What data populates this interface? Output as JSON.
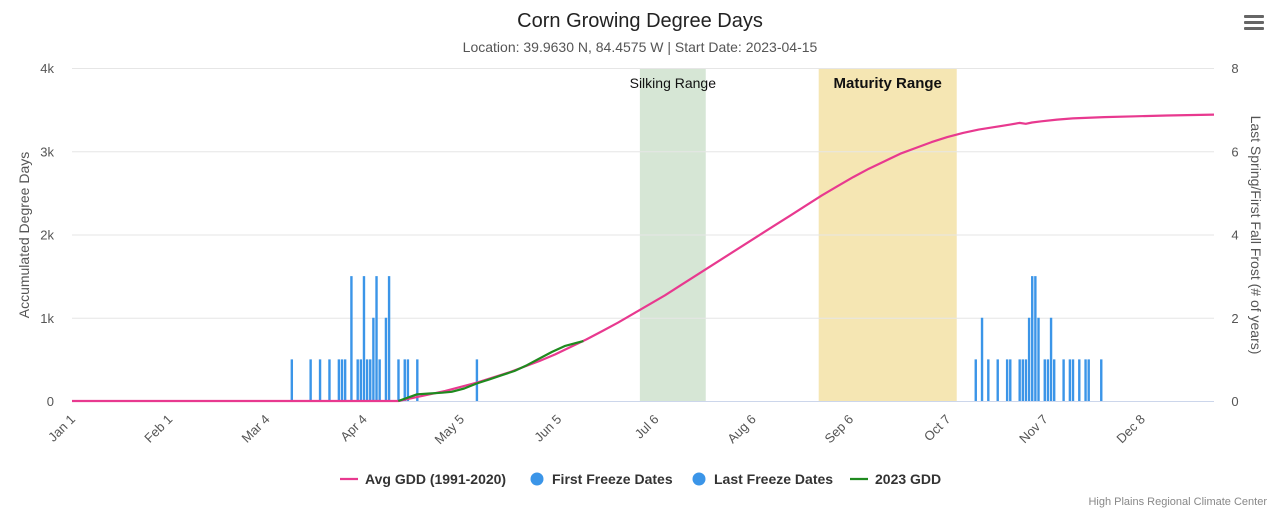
{
  "menu": {
    "icon": "hamburger-menu-icon"
  },
  "credits": "High Plains Regional Climate Center",
  "colors": {
    "avg_gdd": "#e8398f",
    "freeze": "#3b95e8",
    "gdd_2023": "#1f8a1f",
    "silking_band": "#d6e6d5",
    "maturity_band": "#f5e6b3",
    "grid": "#e6e6e6",
    "axis_line": "#ccd6eb"
  },
  "chart_data": {
    "type": "line",
    "title": "Corn Growing Degree Days",
    "subtitle": "Location: 39.9630 N, 84.4575 W | Start Date: 2023-04-15",
    "x_axis": {
      "unit": "day_of_year",
      "range": [
        1,
        365
      ],
      "ticks": [
        {
          "day": 1,
          "label": "Jan 1"
        },
        {
          "day": 32,
          "label": "Feb 1"
        },
        {
          "day": 63,
          "label": "Mar 4"
        },
        {
          "day": 94,
          "label": "Apr 4"
        },
        {
          "day": 125,
          "label": "May 5"
        },
        {
          "day": 156,
          "label": "Jun 5"
        },
        {
          "day": 187,
          "label": "Jul 6"
        },
        {
          "day": 218,
          "label": "Aug 6"
        },
        {
          "day": 249,
          "label": "Sep 6"
        },
        {
          "day": 280,
          "label": "Oct 7"
        },
        {
          "day": 311,
          "label": "Nov 7"
        },
        {
          "day": 342,
          "label": "Dec 8"
        }
      ]
    },
    "y_axis_left": {
      "title": "Accumulated Degree Days",
      "range": [
        0,
        4000
      ],
      "ticks": [
        {
          "value": 0,
          "label": "0"
        },
        {
          "value": 1000,
          "label": "1k"
        },
        {
          "value": 2000,
          "label": "2k"
        },
        {
          "value": 3000,
          "label": "3k"
        },
        {
          "value": 4000,
          "label": "4k"
        }
      ]
    },
    "y_axis_right": {
      "title": "Last Spring/First Fall Frost (# of years)",
      "range": [
        0,
        8
      ],
      "ticks": [
        {
          "value": 0,
          "label": "0"
        },
        {
          "value": 2,
          "label": "2"
        },
        {
          "value": 4,
          "label": "4"
        },
        {
          "value": 6,
          "label": "6"
        },
        {
          "value": 8,
          "label": "8"
        }
      ]
    },
    "grid": true,
    "legend_position": "bottom-center",
    "bands": [
      {
        "name": "Silking Range",
        "from_day": 182,
        "to_day": 203,
        "color_key": "silking_band",
        "bold": false
      },
      {
        "name": "Maturity Range",
        "from_day": 239,
        "to_day": 283,
        "color_key": "maturity_band",
        "bold": true
      }
    ],
    "series": [
      {
        "name": "Avg GDD (1991-2020)",
        "type": "line",
        "axis": "left",
        "color_key": "avg_gdd",
        "legend_symbol": "line",
        "points": [
          [
            1,
            0
          ],
          [
            105,
            0
          ],
          [
            110,
            40
          ],
          [
            115,
            80
          ],
          [
            120,
            120
          ],
          [
            125,
            170
          ],
          [
            130,
            220
          ],
          [
            135,
            280
          ],
          [
            140,
            340
          ],
          [
            145,
            410
          ],
          [
            150,
            480
          ],
          [
            155,
            560
          ],
          [
            160,
            650
          ],
          [
            165,
            740
          ],
          [
            170,
            840
          ],
          [
            175,
            940
          ],
          [
            180,
            1050
          ],
          [
            185,
            1160
          ],
          [
            190,
            1270
          ],
          [
            195,
            1390
          ],
          [
            200,
            1510
          ],
          [
            205,
            1630
          ],
          [
            210,
            1750
          ],
          [
            215,
            1870
          ],
          [
            220,
            1990
          ],
          [
            225,
            2110
          ],
          [
            230,
            2230
          ],
          [
            235,
            2350
          ],
          [
            240,
            2470
          ],
          [
            245,
            2580
          ],
          [
            250,
            2690
          ],
          [
            255,
            2790
          ],
          [
            260,
            2880
          ],
          [
            265,
            2970
          ],
          [
            270,
            3040
          ],
          [
            275,
            3110
          ],
          [
            280,
            3170
          ],
          [
            285,
            3220
          ],
          [
            290,
            3260
          ],
          [
            295,
            3290
          ],
          [
            300,
            3320
          ],
          [
            303,
            3340
          ],
          [
            305,
            3330
          ],
          [
            307,
            3345
          ],
          [
            310,
            3360
          ],
          [
            315,
            3380
          ],
          [
            320,
            3395
          ],
          [
            330,
            3410
          ],
          [
            340,
            3420
          ],
          [
            350,
            3430
          ],
          [
            365,
            3440
          ]
        ]
      },
      {
        "name": "First Freeze Dates",
        "type": "column",
        "axis": "right",
        "color_key": "freeze",
        "legend_symbol": "dot",
        "points": [
          [
            289,
            1
          ],
          [
            291,
            2
          ],
          [
            293,
            1
          ],
          [
            296,
            1
          ],
          [
            299,
            1
          ],
          [
            300,
            1
          ],
          [
            303,
            1
          ],
          [
            304,
            1
          ],
          [
            305,
            1
          ],
          [
            306,
            2
          ],
          [
            307,
            3
          ],
          [
            308,
            3
          ],
          [
            309,
            2
          ],
          [
            311,
            1
          ],
          [
            312,
            1
          ],
          [
            313,
            2
          ],
          [
            314,
            1
          ],
          [
            317,
            1
          ],
          [
            319,
            1
          ],
          [
            320,
            1
          ],
          [
            322,
            1
          ],
          [
            324,
            1
          ],
          [
            325,
            1
          ],
          [
            329,
            1
          ]
        ]
      },
      {
        "name": "Last Freeze Dates",
        "type": "column",
        "axis": "right",
        "color_key": "freeze",
        "legend_symbol": "dot",
        "points": [
          [
            71,
            1
          ],
          [
            77,
            1
          ],
          [
            80,
            1
          ],
          [
            83,
            1
          ],
          [
            86,
            1
          ],
          [
            87,
            1
          ],
          [
            88,
            1
          ],
          [
            90,
            3
          ],
          [
            92,
            1
          ],
          [
            93,
            1
          ],
          [
            94,
            3
          ],
          [
            95,
            1
          ],
          [
            96,
            1
          ],
          [
            97,
            2
          ],
          [
            98,
            3
          ],
          [
            99,
            1
          ],
          [
            101,
            2
          ],
          [
            102,
            3
          ],
          [
            105,
            1
          ],
          [
            107,
            1
          ],
          [
            108,
            1
          ],
          [
            111,
            1
          ],
          [
            130,
            1
          ]
        ]
      },
      {
        "name": "2023 GDD",
        "type": "line",
        "axis": "left",
        "color_key": "gdd_2023",
        "legend_symbol": "line",
        "points": [
          [
            105,
            0
          ],
          [
            108,
            40
          ],
          [
            111,
            80
          ],
          [
            115,
            90
          ],
          [
            119,
            100
          ],
          [
            122,
            110
          ],
          [
            126,
            150
          ],
          [
            130,
            210
          ],
          [
            134,
            260
          ],
          [
            138,
            310
          ],
          [
            142,
            360
          ],
          [
            146,
            430
          ],
          [
            150,
            510
          ],
          [
            154,
            590
          ],
          [
            158,
            660
          ],
          [
            162,
            700
          ],
          [
            164,
            720
          ]
        ]
      }
    ]
  }
}
